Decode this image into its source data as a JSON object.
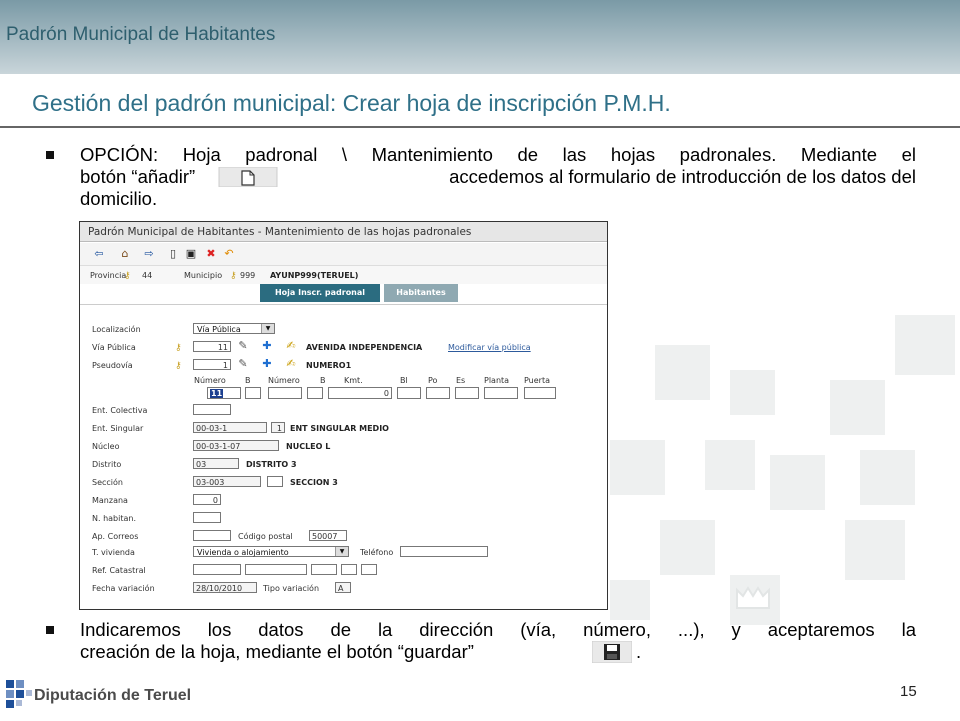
{
  "header": {
    "section_title": "Padrón Municipal de Habitantes"
  },
  "slide": {
    "title": "Gestión del padrón municipal: Crear hoja de inscripción P.M.H.",
    "bullet1": {
      "line1": "OPCIÓN: Hoja padronal \\ Mantenimiento de las hojas padronales. Mediante el",
      "line2a": "botón “añadir”",
      "line2b": "accedemos al formulario de introducción de los datos del",
      "line3": "domicilio."
    },
    "bullet2": {
      "line1": "Indicaremos los datos de la dirección (vía, número, ...), y aceptaremos la",
      "line2a": "creación de la hoja, mediante el botón “guardar”",
      "line2b": "."
    },
    "page_number": "15",
    "logo_text": "Diputación de Teruel"
  },
  "app": {
    "window_title": "Padrón Municipal de Habitantes - Mantenimiento de las hojas padronales",
    "toolbar_icons": [
      "arrow-left-icon",
      "home-icon",
      "arrow-right-icon",
      "new-document-icon",
      "save-icon",
      "delete-icon",
      "undo-icon"
    ],
    "provincia_label": "Provincia",
    "provincia_value": "44",
    "municipio_label": "Municipio",
    "municipio_value": "999",
    "municipio_name": "AYUNP999(TERUEL)",
    "tabs": [
      "Hoja Inscr. padronal",
      "Habitantes"
    ],
    "form": {
      "localizacion_label": "Localización",
      "localizacion_value": "Vía Pública",
      "via_publica_label": "Vía Pública",
      "via_publica_value": "11",
      "via_publica_name": "AVENIDA INDEPENDENCIA",
      "modificar_link": "Modificar vía pública",
      "pseudovia_label": "Pseudovía",
      "pseudovia_value": "1",
      "pseudovia_name": "NUMERO1",
      "number_headers": [
        "Número",
        "B",
        "Número",
        "B",
        "Kmt.",
        "Bl",
        "Po",
        "Es",
        "Planta",
        "Puerta"
      ],
      "numero_value": "11",
      "kmt_value": "0",
      "ent_colectiva_label": "Ent. Colectiva",
      "ent_singular_label": "Ent. Singular",
      "ent_singular_code": "00-03-1",
      "ent_singular_num": "1",
      "ent_singular_name": "ENT SINGULAR MEDIO",
      "nucleo_label": "Núcleo",
      "nucleo_code": "00-03-1-07",
      "nucleo_name": "NUCLEO L",
      "distrito_label": "Distrito",
      "distrito_code": "03",
      "distrito_name": "DISTRITO 3",
      "seccion_label": "Sección",
      "seccion_code": "03-003",
      "seccion_name": "SECCION 3",
      "manzana_label": "Manzana",
      "manzana_value": "0",
      "n_habitan_label": "N. habitan.",
      "ap_correos_label": "Ap. Correos",
      "codigo_postal_label": "Código postal",
      "codigo_postal_value": "50007",
      "t_vivienda_label": "T. vivienda",
      "t_vivienda_value": "Vivienda o alojamiento",
      "telefono_label": "Teléfono",
      "ref_catastral_label": "Ref. Catastral",
      "fecha_variacion_label": "Fecha variación",
      "fecha_variacion_value": "28/10/2010",
      "tipo_variacion_label": "Tipo variación",
      "tipo_variacion_value": "A"
    }
  },
  "colors": {
    "header_gradient_top": "#7a9aa6",
    "title": "#2f7088",
    "tab_active": "#2b6c80",
    "tab_inactive": "#8fa9b2"
  }
}
